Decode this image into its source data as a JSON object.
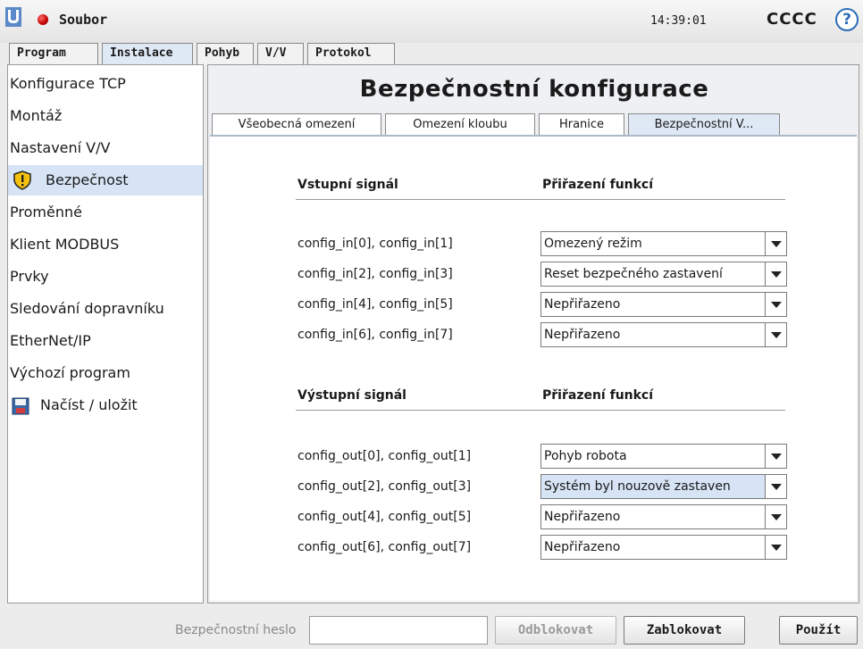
{
  "topbar": {
    "file_label": "Soubor",
    "time": "14:39:01",
    "robot_name": "CCCC",
    "help_symbol": "?",
    "status_color": "#c00000"
  },
  "main_tabs": [
    {
      "label": "Program"
    },
    {
      "label": "Instalace"
    },
    {
      "label": "Pohyb"
    },
    {
      "label": "V/V"
    },
    {
      "label": "Protokol"
    }
  ],
  "sidebar": {
    "items": [
      {
        "label": "Konfigurace TCP"
      },
      {
        "label": "Montáž"
      },
      {
        "label": "Nastavení V/V"
      },
      {
        "label": "Bezpečnost",
        "icon": "shield-warning-icon"
      },
      {
        "label": "Proměnné"
      },
      {
        "label": "Klient MODBUS"
      },
      {
        "label": "Prvky"
      },
      {
        "label": "Sledování dopravníku"
      },
      {
        "label": "EtherNet/IP"
      },
      {
        "label": "Výchozí program"
      },
      {
        "label": "Načíst / uložit",
        "icon": "save-disk-icon"
      }
    ]
  },
  "content": {
    "title": "Bezpečnostní konfigurace",
    "sub_tabs": [
      {
        "label": "Všeobecná omezení"
      },
      {
        "label": "Omezení kloubu"
      },
      {
        "label": "Hranice"
      },
      {
        "label": "Bezpečnostní V..."
      }
    ],
    "input_section": {
      "signal_header": "Vstupní signál",
      "function_header": "Přiřazení funkcí",
      "rows": [
        {
          "signal": "config_in[0], config_in[1]",
          "function": "Omezený režim"
        },
        {
          "signal": "config_in[2], config_in[3]",
          "function": "Reset bezpečného zastavení"
        },
        {
          "signal": "config_in[4], config_in[5]",
          "function": "Nepřiřazeno"
        },
        {
          "signal": "config_in[6], config_in[7]",
          "function": "Nepřiřazeno"
        }
      ]
    },
    "output_section": {
      "signal_header": "Výstupní signál",
      "function_header": "Přiřazení funkcí",
      "rows": [
        {
          "signal": "config_out[0], config_out[1]",
          "function": "Pohyb robota"
        },
        {
          "signal": "config_out[2], config_out[3]",
          "function": "Systém byl nouzově zastaven"
        },
        {
          "signal": "config_out[4], config_out[5]",
          "function": "Nepřiřazeno"
        },
        {
          "signal": "config_out[6], config_out[7]",
          "function": "Nepřiřazeno"
        }
      ]
    }
  },
  "bottombar": {
    "password_label": "Bezpečnostní heslo",
    "password_value": "",
    "unlock_label": "Odblokovat",
    "lock_label": "Zablokovat",
    "apply_label": "Použít"
  }
}
